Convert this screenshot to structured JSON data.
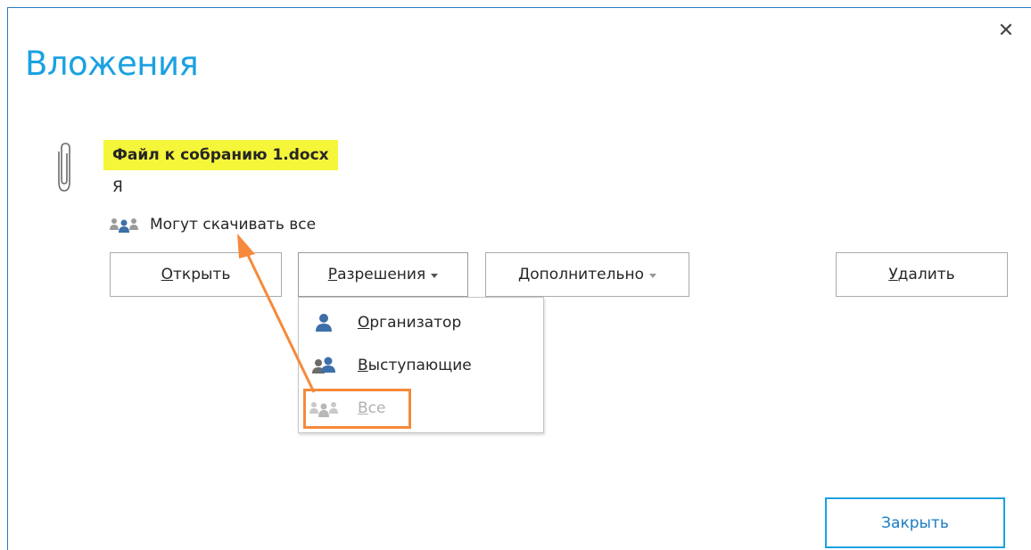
{
  "dialog": {
    "title": "Вложения",
    "close_icon": "close-icon"
  },
  "attachment": {
    "file_name": "Файл к собранию 1.docx",
    "owner": "Я",
    "permission_text": "Могут скачивать все",
    "icon": "paperclip-icon"
  },
  "buttons": {
    "open": {
      "accel": "О",
      "rest": "ткрыть"
    },
    "permissions": {
      "accel": "Р",
      "rest": "азрешения"
    },
    "more": {
      "accel": "Д",
      "rest": "ополнительно"
    },
    "delete": {
      "accel": "У",
      "rest": "далить"
    },
    "close": "Закрыть"
  },
  "permissions_menu": {
    "items": [
      {
        "accel": "О",
        "rest": "рганизатор",
        "icon": "organizer-person-icon",
        "enabled": true
      },
      {
        "accel": "В",
        "rest": "ыступающие",
        "icon": "presenters-icon",
        "enabled": true
      },
      {
        "accel": "В",
        "rest": "се",
        "icon": "everyone-icon",
        "enabled": false
      }
    ]
  },
  "colors": {
    "title": "#1ba1e2",
    "highlight": "#f5f53a",
    "annotation": "#f6893b",
    "accent_border": "#2b78c5",
    "close_button_text": "#1a7dc4"
  }
}
